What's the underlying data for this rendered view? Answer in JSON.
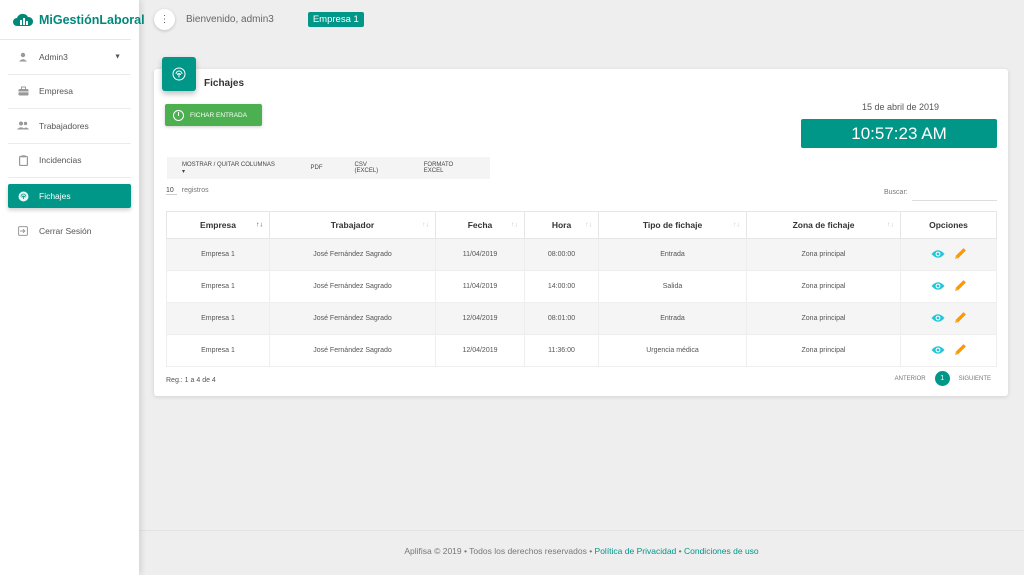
{
  "brand": {
    "name": "MiGestiónLaboral",
    "color": "#00897b"
  },
  "sidebar": {
    "items": [
      {
        "label": "Admin3",
        "icon": "person-icon"
      },
      {
        "label": "Empresa",
        "icon": "briefcase-icon"
      },
      {
        "label": "Trabajadores",
        "icon": "group-icon"
      },
      {
        "label": "Incidencias",
        "icon": "clipboard-icon"
      },
      {
        "label": "Fichajes",
        "icon": "fingerprint-icon",
        "active": true
      },
      {
        "label": "Cerrar Sesión",
        "icon": "exit-icon"
      }
    ]
  },
  "topbar": {
    "welcome": "Bienvenido, admin3",
    "company": "Empresa 1"
  },
  "card": {
    "title": "Fichajes",
    "fichar_button": "FICHAR ENTRADA",
    "date": "15 de abril de 2019",
    "clock": "10:57:23 AM"
  },
  "export_buttons": [
    "MOSTRAR / QUITAR COLUMNAS ▾",
    "PDF",
    "CSV (EXCEL)",
    "FORMATO EXCEL"
  ],
  "length": {
    "value": "10",
    "label": "registros"
  },
  "search": {
    "label": "Buscar:",
    "value": ""
  },
  "table": {
    "headers": [
      "Empresa",
      "Trabajador",
      "Fecha",
      "Hora",
      "Tipo de fichaje",
      "Zona de fichaje",
      "Opciones"
    ],
    "rows": [
      [
        "Empresa 1",
        "José Fernández Sagrado",
        "11/04/2019",
        "08:00:00",
        "Entrada",
        "Zona principal"
      ],
      [
        "Empresa 1",
        "José Fernández Sagrado",
        "11/04/2019",
        "14:00:00",
        "Salida",
        "Zona principal"
      ],
      [
        "Empresa 1",
        "José Fernández Sagrado",
        "12/04/2019",
        "08:01:00",
        "Entrada",
        "Zona principal"
      ],
      [
        "Empresa 1",
        "José Fernández Sagrado",
        "12/04/2019",
        "11:36:00",
        "Urgencia médica",
        "Zona principal"
      ]
    ]
  },
  "table_info": "Reg.: 1 a 4 de 4",
  "pager": {
    "prev": "ANTERIOR",
    "page": "1",
    "next": "SIGUIENTE"
  },
  "footer": {
    "text": "Aplifisa © 2019 • Todos los derechos reservados • ",
    "privacy": "Política de Privacidad",
    "sep": " • ",
    "terms": "Condiciones de uso"
  },
  "colors": {
    "accent": "#009688",
    "green": "#4caf50",
    "eye": "#26c6da",
    "pencil": "#ff9800"
  }
}
